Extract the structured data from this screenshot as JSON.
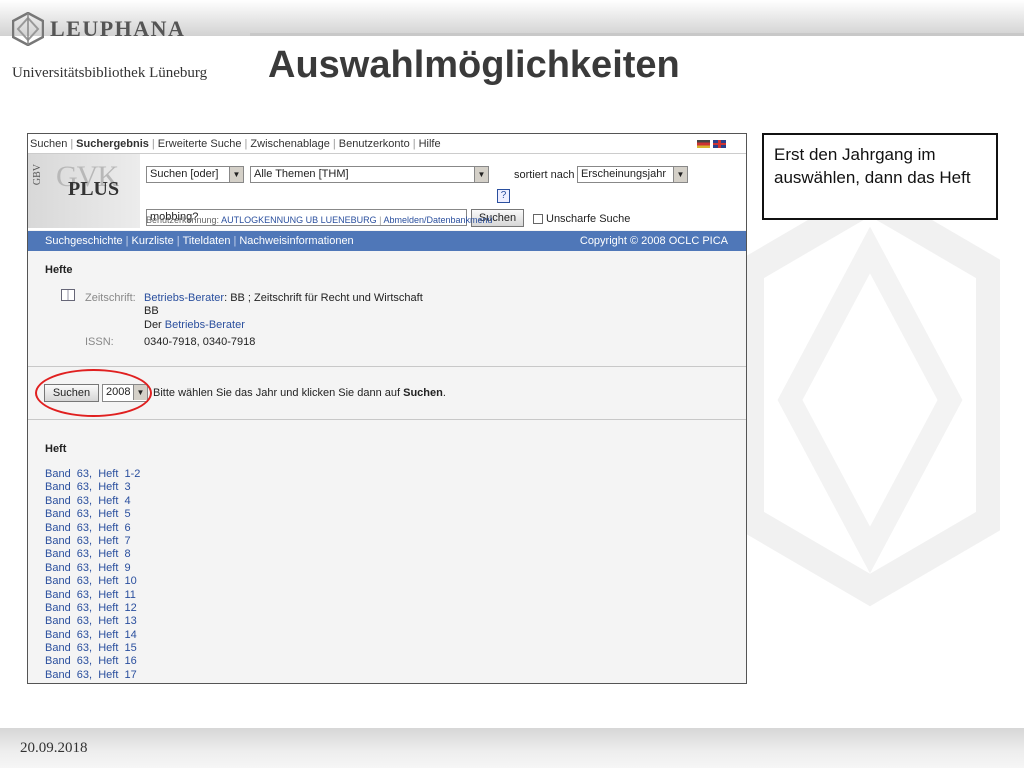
{
  "slide": {
    "logo_text": "LEUPHANA",
    "logo_sub": "Universitätsbibliothek Lüneburg",
    "title": "Auswahlmöglichkeiten",
    "callout": "Erst den Jahrgang im auswählen, dann das Heft",
    "date": "20.09.2018"
  },
  "app": {
    "nav": [
      "Suchen",
      "Suchergebnis",
      "Erweiterte Suche",
      "Zwischenablage",
      "Benutzerkonto",
      "Hilfe"
    ],
    "nav_current": "Suchergebnis",
    "logo_side": "GBV",
    "logo_big": "GVK",
    "logo_plus": "PLUS",
    "search": {
      "mode": "Suchen [oder]",
      "topic": "Alle Themen [THM]",
      "help": "?",
      "sort_label": "sortiert nach",
      "sort_value": "Erscheinungsjahr",
      "query": "mobbing?",
      "button": "Suchen",
      "fuzzy": "Unscharfe Suche",
      "user_label": "Benutzerkennung:",
      "user_value": "AUTLOGKENNUNG UB LUENEBURG",
      "user_link": "Abmelden/Datenbankmenü"
    },
    "subnav": [
      "Suchgeschichte",
      "Kurzliste",
      "Titeldaten",
      "Nachweisinformationen"
    ],
    "copyright": "Copyright © 2008 OCLC PICA",
    "hefte": {
      "title": "Hefte",
      "zeitschrift_label": "Zeitschrift:",
      "zeitschrift_link": "Betriebs-Berater",
      "zeitschrift_rest": ": BB ; Zeitschrift für Recht und Wirtschaft",
      "line2": "BB",
      "line3_prefix": "Der",
      "line3_link": "Betriebs-Berater",
      "issn_label": "ISSN:",
      "issn_value": "0340-7918, 0340-7918"
    },
    "year": {
      "button": "Suchen",
      "value": "2008",
      "hint_prefix": "Bitte wählen Sie das Jahr und klicken Sie dann auf",
      "hint_bold": "Suchen",
      "hint_suffix": "."
    },
    "heft": {
      "title": "Heft",
      "items": [
        "Band  63,  Heft  1-2",
        "Band  63,  Heft  3",
        "Band  63,  Heft  4",
        "Band  63,  Heft  5",
        "Band  63,  Heft  6",
        "Band  63,  Heft  7",
        "Band  63,  Heft  8",
        "Band  63,  Heft  9",
        "Band  63,  Heft  10",
        "Band  63,  Heft  11",
        "Band  63,  Heft  12",
        "Band  63,  Heft  13",
        "Band  63,  Heft  14",
        "Band  63,  Heft  15",
        "Band  63,  Heft  16",
        "Band  63,  Heft  17"
      ]
    }
  }
}
